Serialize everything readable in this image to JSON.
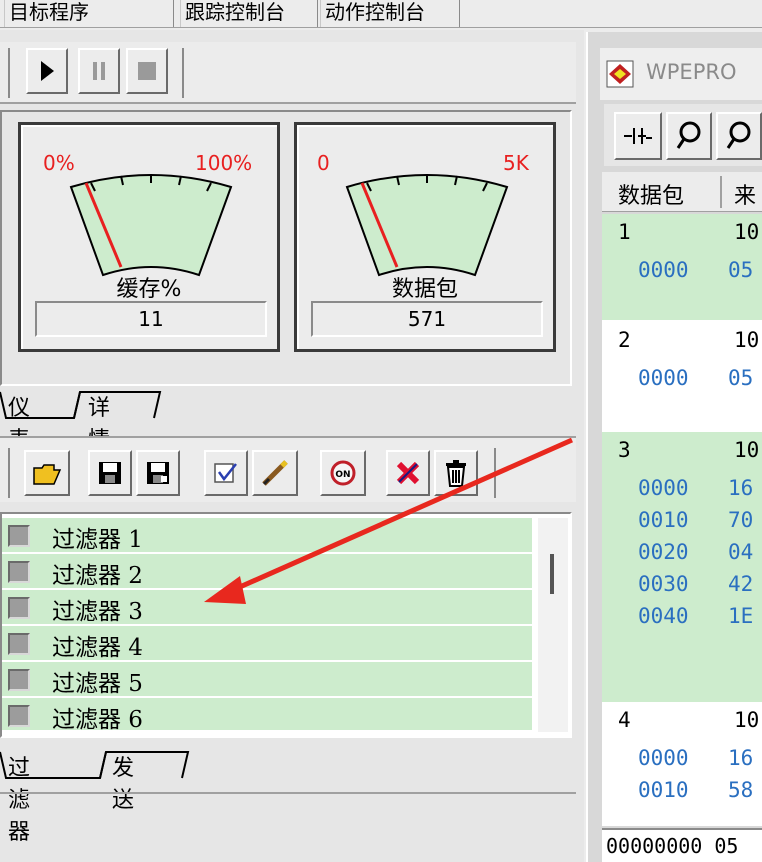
{
  "top_tabs": [
    "目标程序",
    "跟踪控制台",
    "动作控制台"
  ],
  "meters": [
    {
      "min_label": "0%",
      "max_label": "100%",
      "caption": "缓存%",
      "value": "11",
      "needle_fraction": 0.11
    },
    {
      "min_label": "0",
      "max_label": "5K",
      "caption": "数据包",
      "value": "571",
      "needle_fraction": 0.11
    }
  ],
  "meter_tabs": [
    "仪表",
    "详情"
  ],
  "filters": [
    "过滤器 1",
    "过滤器 2",
    "过滤器 3",
    "过滤器 4",
    "过滤器 5",
    "过滤器 6"
  ],
  "bottom_tabs": [
    "过滤器",
    "发送"
  ],
  "toolbar_icons": [
    "play-icon",
    "pause-icon",
    "stop-icon"
  ],
  "filter_toolbar_icons": [
    "open-folder-icon",
    "save-icon",
    "save-as-icon",
    "edit-check-icon",
    "edit-pen-icon",
    "on-toggle-icon",
    "delete-x-icon",
    "trash-icon"
  ],
  "packet_window": {
    "title": "WPEPRO",
    "columns": [
      "数据包",
      "来"
    ],
    "packets": [
      {
        "num": "1",
        "src": "10",
        "rows": [
          {
            "off": "0000",
            "hex": "05"
          }
        ]
      },
      {
        "num": "2",
        "src": "10",
        "rows": [
          {
            "off": "0000",
            "hex": "05"
          }
        ]
      },
      {
        "num": "3",
        "src": "10",
        "rows": [
          {
            "off": "0000",
            "hex": "16"
          },
          {
            "off": "0010",
            "hex": "70"
          },
          {
            "off": "0020",
            "hex": "04"
          },
          {
            "off": "0030",
            "hex": "42"
          },
          {
            "off": "0040",
            "hex": "1E"
          }
        ]
      },
      {
        "num": "4",
        "src": "10",
        "rows": [
          {
            "off": "0000",
            "hex": "16"
          },
          {
            "off": "0010",
            "hex": "58"
          }
        ]
      }
    ],
    "status": "00000000 05"
  },
  "colors": {
    "accent_green": "#cdeccd",
    "meter_red": "#e82020",
    "arrow_red": "#e8281e",
    "offset_blue": "#2a6fc0"
  }
}
